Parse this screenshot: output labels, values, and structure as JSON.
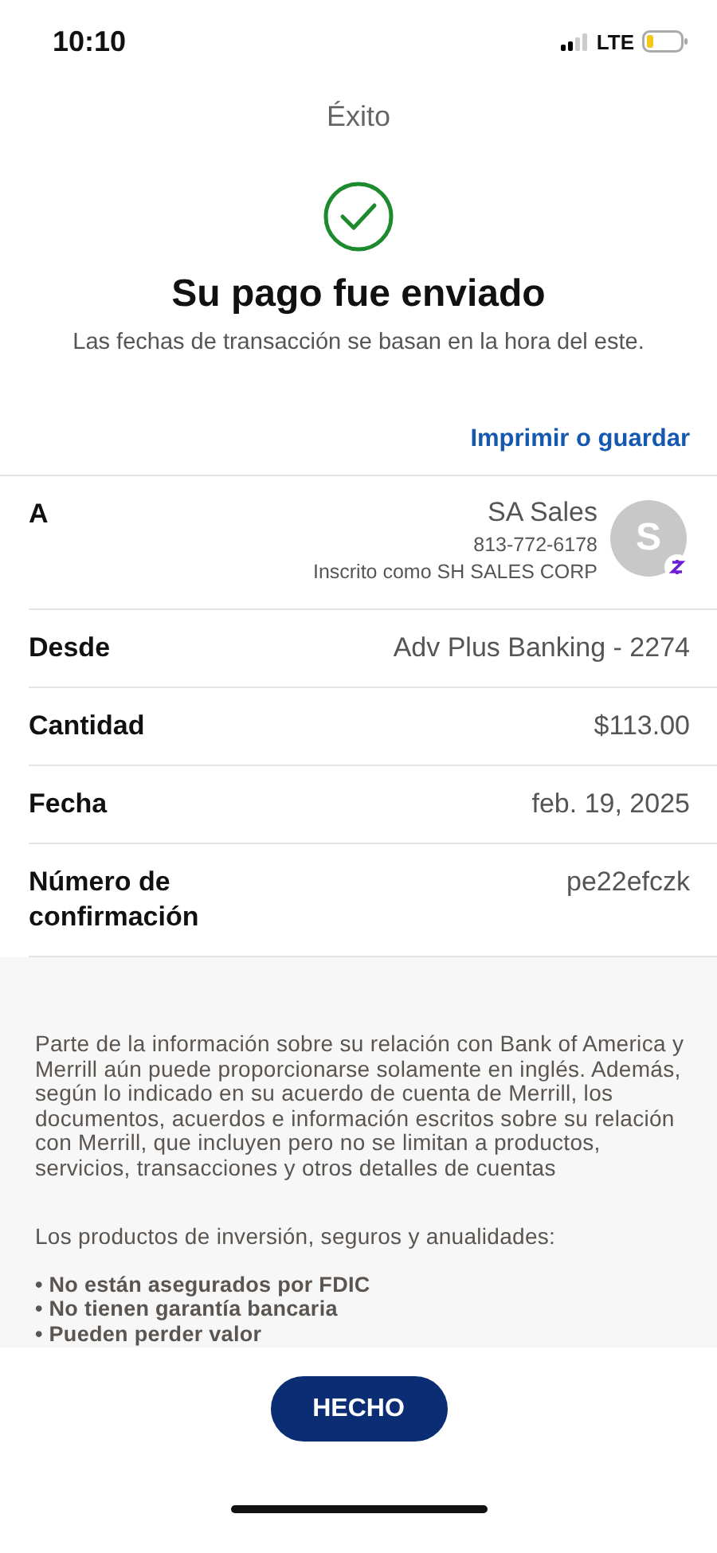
{
  "status_bar": {
    "time": "10:10",
    "network": "LTE"
  },
  "nav": {
    "title": "Éxito"
  },
  "result": {
    "heading": "Su pago fue enviado",
    "note": "Las fechas de transacción se basan en la hora del este."
  },
  "print_link": "Imprimir o guardar",
  "details": [
    {
      "kind": "recipient",
      "label": "A",
      "name": "SA Sales",
      "phone": "813-772-6178",
      "enrolled": "Inscrito como SH SALES CORP",
      "avatar": "S"
    },
    {
      "kind": "simple",
      "label": "Desde",
      "value": "Adv Plus Banking - 2274"
    },
    {
      "kind": "simple",
      "label": "Cantidad",
      "value": "$113.00"
    },
    {
      "kind": "simple",
      "label": "Fecha",
      "value": "feb. 19, 2025"
    },
    {
      "kind": "simple",
      "label": "Número de confirmación",
      "value": "pe22efczk"
    }
  ],
  "disclosure": {
    "paragraphs": [
      "Parte de la información sobre su relación con Bank of America y Merrill aún puede proporcionarse solamente en inglés. Además, según lo indicado en su acuerdo de cuenta de Merrill, los documentos, acuerdos e información escritos sobre su relación con Merrill, que incluyen pero no se limitan a productos, servicios, transacciones y otros detalles de cuentas",
      "Los productos de inversión, seguros y anualidades:"
    ],
    "bullets": [
      "• No están asegurados por FDIC",
      "• No tienen garantía bancaria",
      "• Pueden perder valor"
    ]
  },
  "done_button": "HECHO"
}
